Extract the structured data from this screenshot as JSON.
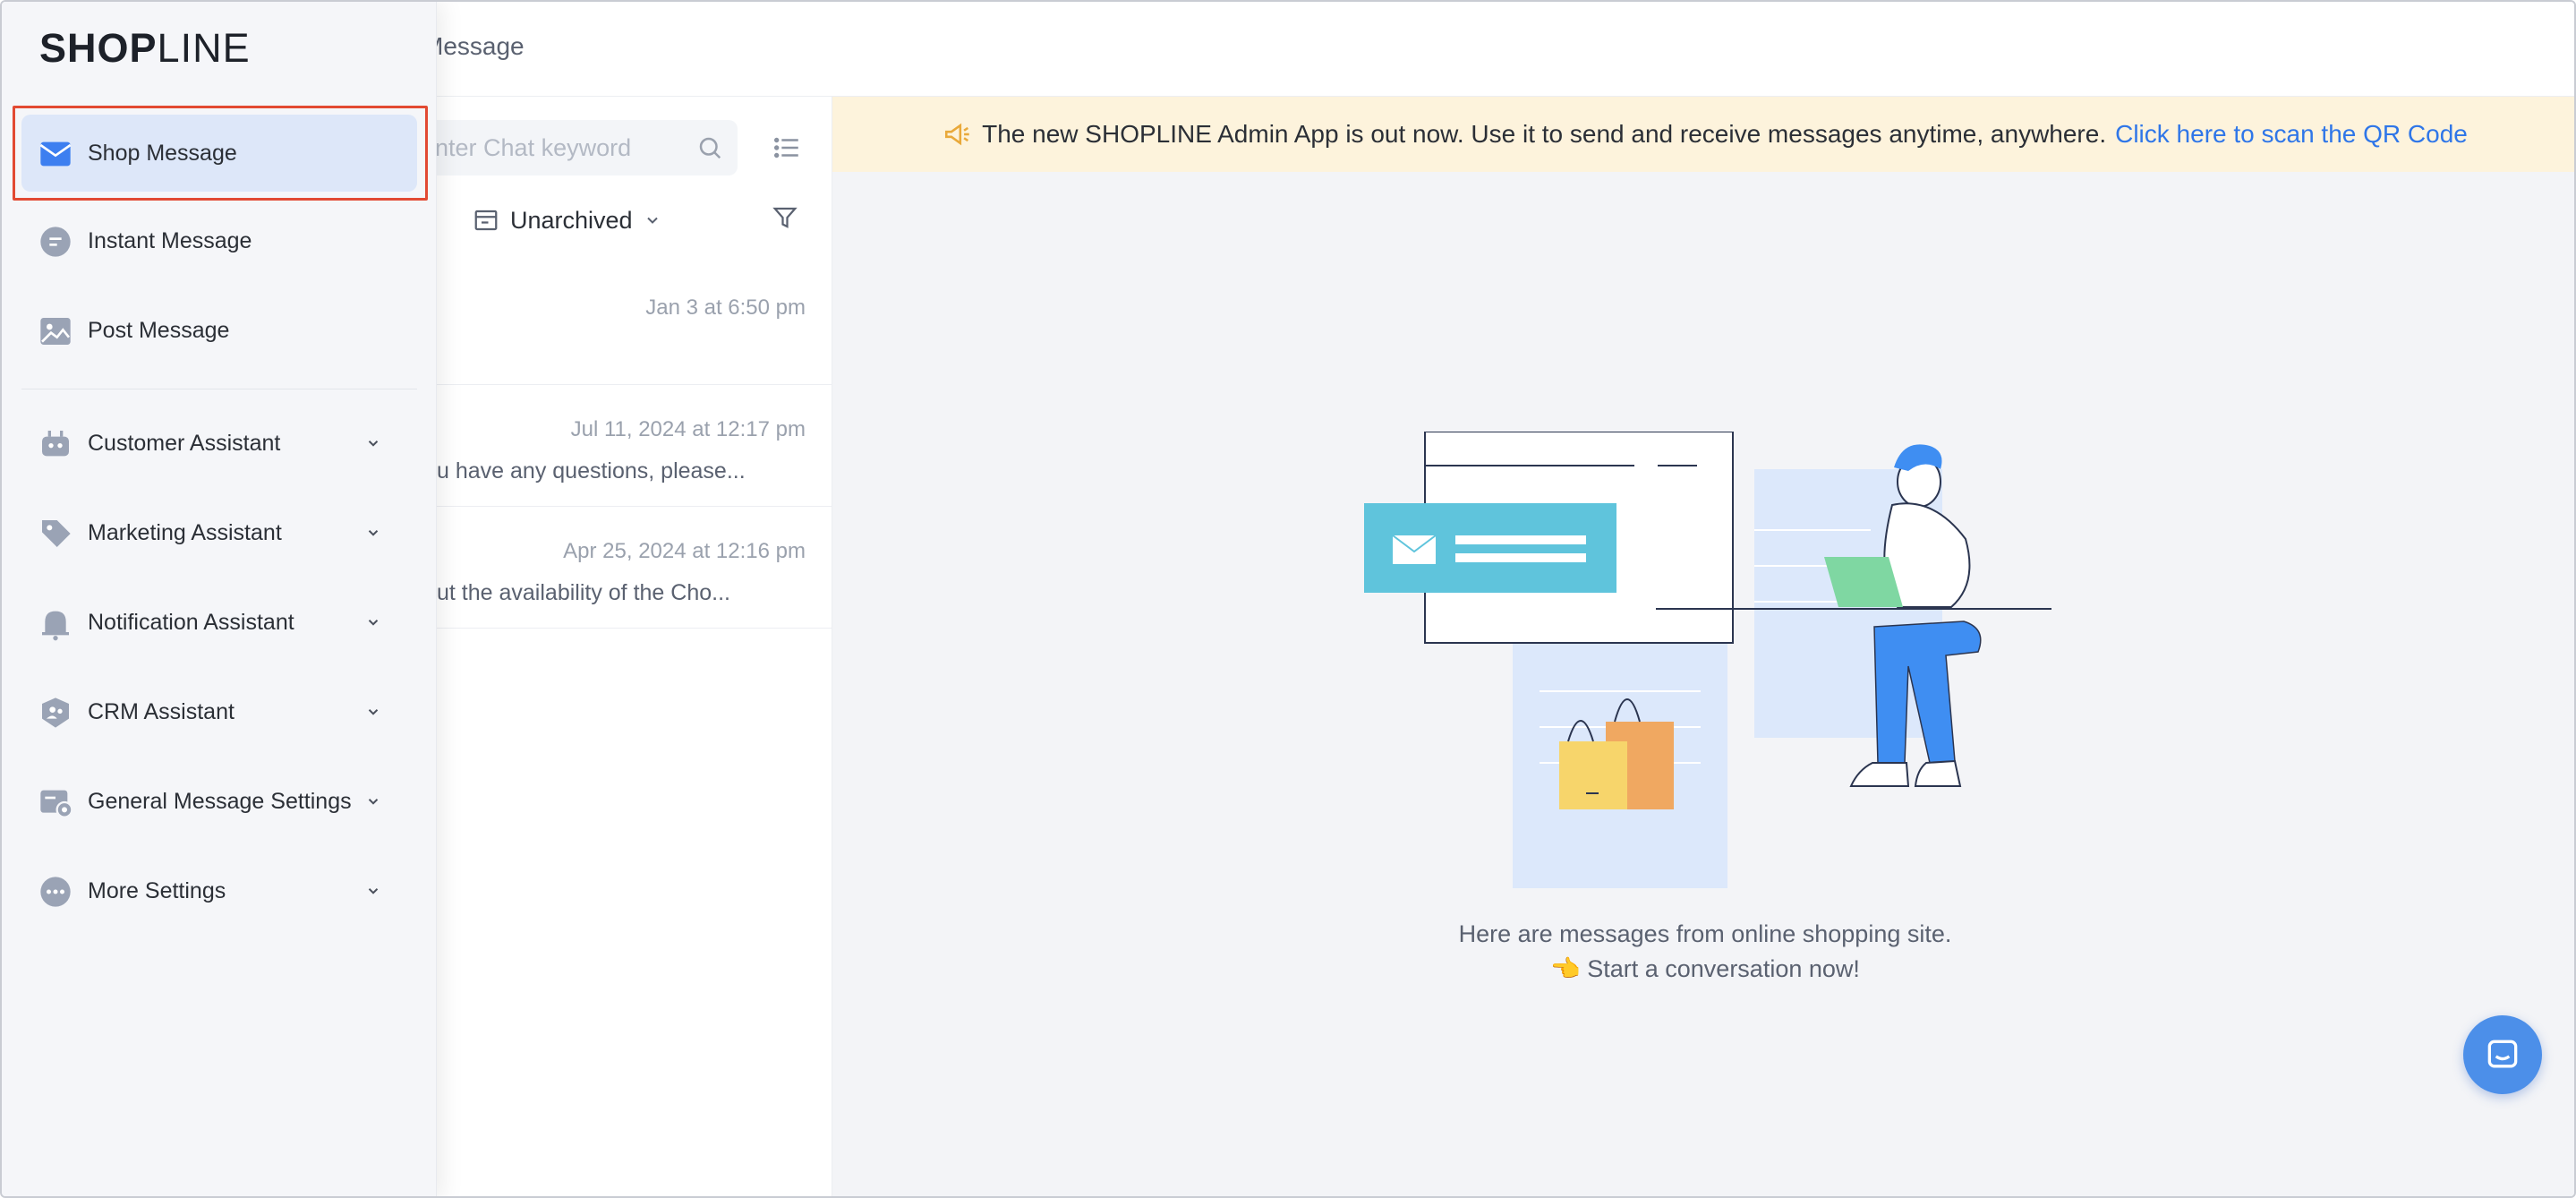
{
  "header": {
    "title": "Message"
  },
  "search": {
    "placeholder": "Enter Chat keyword"
  },
  "filters": {
    "archive_label": "Unarchived"
  },
  "conversations": [
    {
      "time": "Jan 3 at 6:50 pm",
      "preview": ""
    },
    {
      "time": "Jul 11, 2024 at 12:17 pm",
      "preview": "u have any questions, please..."
    },
    {
      "time": "Apr 25, 2024 at 12:16 pm",
      "preview": "ut the availability of the Cho..."
    }
  ],
  "banner": {
    "text": "The new SHOPLINE Admin App is out now. Use it to send and receive messages anytime, anywhere.",
    "link": "Click here to scan the QR Code"
  },
  "empty_state": {
    "line1": "Here are messages from online shopping site.",
    "line2": "👈 Start a conversation now!"
  },
  "sidebar": {
    "logo": {
      "left": "SH",
      "o": "O",
      "mid": "P",
      "right": "LINE"
    },
    "items": [
      {
        "label": "Shop Message",
        "icon": "envelope-icon",
        "active": true
      },
      {
        "label": "Instant Message",
        "icon": "chat-bubble-icon"
      },
      {
        "label": "Post Message",
        "icon": "image-icon"
      },
      {
        "label": "Customer Assistant",
        "icon": "robot-icon",
        "expandable": true
      },
      {
        "label": "Marketing Assistant",
        "icon": "tag-icon",
        "expandable": true
      },
      {
        "label": "Notification Assistant",
        "icon": "bell-icon",
        "expandable": true
      },
      {
        "label": "CRM Assistant",
        "icon": "crm-shield-icon",
        "expandable": true
      },
      {
        "label": "General Message Settings",
        "icon": "settings-card-icon",
        "expandable": true
      },
      {
        "label": "More Settings",
        "icon": "more-icon",
        "expandable": true
      }
    ]
  },
  "colors": {
    "accent": "#2f76e8",
    "banner_bg": "#fdf3dc",
    "active_item_bg": "#dde7f9",
    "highlight_border": "#e24a33",
    "chat_button": "#4c8fe9"
  }
}
